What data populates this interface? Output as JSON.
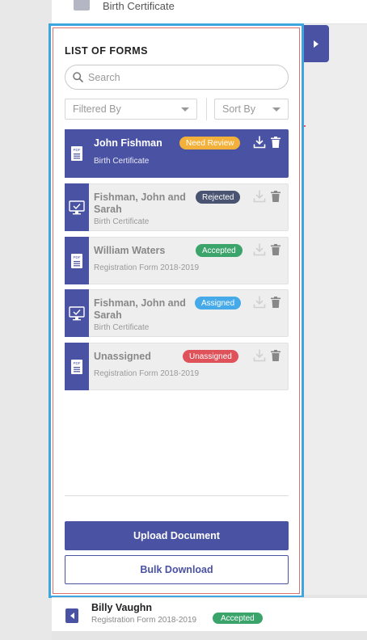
{
  "background_list": {
    "top_item_label": "Birth Certificate",
    "bottom_item": {
      "name": "Billy Vaughn",
      "subtitle": "Registration Form 2018-2019",
      "status": "Accepted"
    }
  },
  "panel": {
    "title": "LIST OF FORMS",
    "search_placeholder": "Search",
    "filter_label": "Filtered By",
    "sort_label": "Sort By",
    "upload_label": "Upload Document",
    "bulk_download_label": "Bulk Download"
  },
  "forms": [
    {
      "name": "John Fishman",
      "subtitle": "Birth Certificate",
      "status": "Need Review",
      "status_color": "#f3b13c",
      "icon": "pdf-document-icon",
      "active": true
    },
    {
      "name": "Fishman, John and Sarah",
      "subtitle": "Birth Certificate",
      "status": "Rejected",
      "status_color": "#4a5371",
      "icon": "monitor-check-icon",
      "active": false
    },
    {
      "name": "William Waters",
      "subtitle": "Registration Form 2018-2019",
      "status": "Accepted",
      "status_color": "#3aa46b",
      "icon": "pdf-document-icon",
      "active": false
    },
    {
      "name": "Fishman, John and Sarah",
      "subtitle": "Birth Certificate",
      "status": "Assigned",
      "status_color": "#46a9e8",
      "icon": "monitor-check-icon",
      "active": false
    },
    {
      "name": "Unassigned",
      "subtitle": "Registration Form 2018-2019",
      "status": "Unassigned",
      "status_color": "#e0525a",
      "icon": "pdf-document-icon",
      "active": false
    }
  ],
  "colors": {
    "accent": "#4a52a3",
    "panel_border": "#3ea5de",
    "accepted": "#3aa46b"
  }
}
